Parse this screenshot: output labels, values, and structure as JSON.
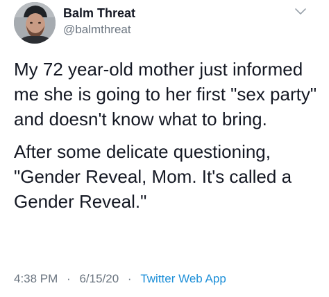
{
  "tweet": {
    "author_name": "Balm Threat",
    "author_handle": "@balmthreat",
    "paragraphs": [
      "My 72 year-old mother just informed me she is going to her first \"sex party\" and doesn't know what to bring.",
      "After some delicate questioning, \"Gender Reveal, Mom. It's called a Gender Reveal.\""
    ],
    "time": "4:38 PM",
    "separator": "·",
    "date": "6/15/20",
    "source": "Twitter Web App"
  },
  "icons": {
    "menu": "chevron-down-icon",
    "avatar": "profile-photo"
  },
  "colors": {
    "text": "#141823",
    "secondary": "#6b7580",
    "link": "#1d8fd8"
  }
}
